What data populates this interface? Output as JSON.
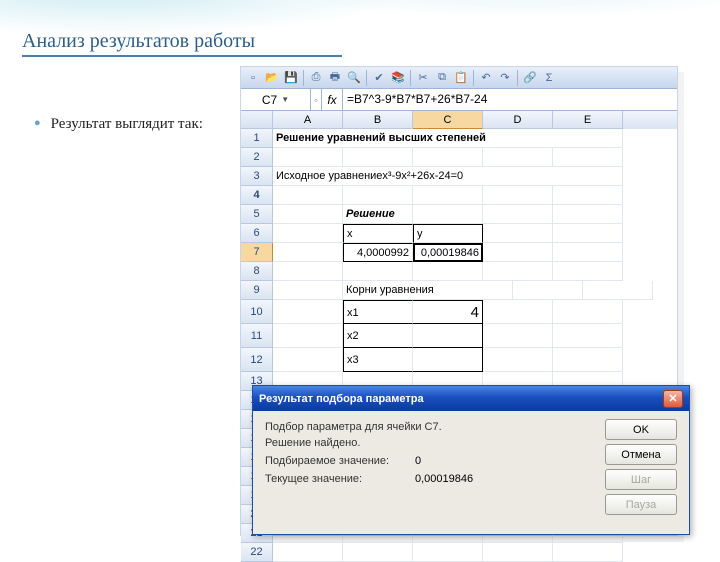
{
  "slide": {
    "title": "Анализ результатов работы",
    "bullet": "Результат выглядит так:"
  },
  "excel": {
    "namebox": "C7",
    "formula": "=B7^3-9*B7*B7+26*B7-24",
    "columns": [
      "A",
      "B",
      "C",
      "D",
      "E"
    ],
    "row1": "Решение уравнений высших степеней",
    "row3": "Исходное уравнениеx³-9x²+26x-24=0",
    "row5": "Решение",
    "row6b": "x",
    "row6c": "y",
    "row7b": "4,0000992",
    "row7c": "0,00019846",
    "row9": "Корни уравнения",
    "row10b": "x1",
    "row10c": "4",
    "row11b": "x2",
    "row12b": "x3"
  },
  "dialog": {
    "title": "Результат подбора параметра",
    "line1": "Подбор параметра для ячейки C7.",
    "line2": "Решение найдено.",
    "k1": "Подбираемое значение:",
    "v1": "0",
    "k2": "Текущее значение:",
    "v2": "0,00019846",
    "ok": "OK",
    "cancel": "Отмена",
    "step": "Шаг",
    "pause": "Пауза"
  }
}
